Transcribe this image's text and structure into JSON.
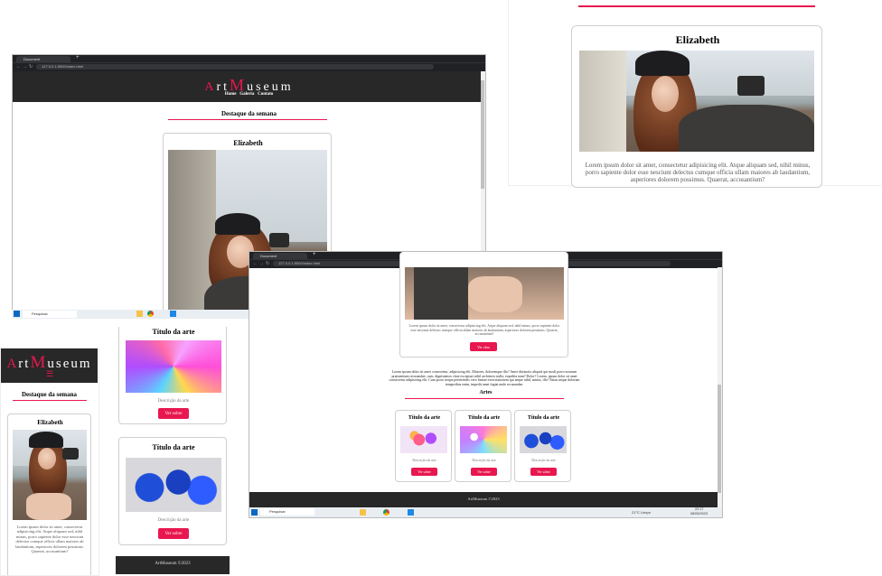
{
  "brand": {
    "first": "Art",
    "second": "Museum",
    "a_letter": "A",
    "rt": "rt",
    "m_letter": "M",
    "useum": "useum"
  },
  "nav": {
    "home": "Home",
    "galeria": "Galeria",
    "contato": "Contato"
  },
  "browser": {
    "tab_title": "Document",
    "url": "127.0.0.1:5500/index.html",
    "new_tab": "+"
  },
  "featured": {
    "section_title": "Destaque da semana",
    "artist_name": "Elizabeth",
    "description": "Lorem ipsum dolor sit amet, consectetur adipisicing elit. Atque aliquam sed, nihil minus, porro sapiente dolor esse nesciunt delectus cumque officia ullam maiores ab laudantium, asperiores dolorem possimus. Quaerat, accusantium?",
    "button": "Ver obra"
  },
  "about": "Lorem ipsum dolor sit amet consectetur, adipisicing elit. Maiores, doloremque illo? Amet distinctio aliquid qui modi porro nostrum praesentium recusandae, cum, dignissimos vitae excepturi nihil architecto nulla, expedita nam? Dolor? Lorem, ipsum dolor sit amet consectetur adipisicing elit. Cum porro neque perferendis vero beatae exercitationem qui neque nihil, minus, illo! Natus neque dolorum temporibus enim, impedit amet fugiat unde recusandae.",
  "arts": {
    "section_title": "Artes",
    "items": [
      {
        "title": "Título da arte",
        "desc": "Descrição da arte",
        "button": "Ver sobre"
      },
      {
        "title": "Título da arte",
        "desc": "Descrição da arte",
        "button": "Ver sobre"
      },
      {
        "title": "Título da arte",
        "desc": "Descrição da arte",
        "button": "Ver sobre"
      }
    ]
  },
  "footer": "ArtMuseum ©2023",
  "taskbar": {
    "search": "Pesquisar",
    "weather": "21°C  Limpo",
    "time": "22:17",
    "date": "08/05/2023"
  },
  "colors": {
    "accent": "#e8174f",
    "header_bg": "#282828",
    "footer_bg": "#282828"
  }
}
